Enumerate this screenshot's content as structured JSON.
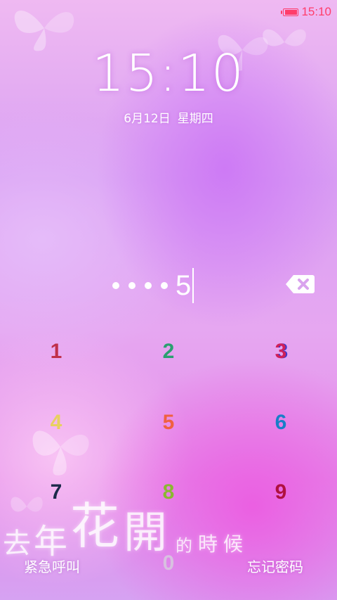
{
  "status_bar": {
    "time": "15:10",
    "battery_level": 0.95,
    "accent": "#ff3d6b"
  },
  "clock": {
    "time": "15:10"
  },
  "date": {
    "day": "6月12日",
    "weekday": "星期四"
  },
  "pin": {
    "masked_count": 4,
    "last_digit": "5"
  },
  "keypad": {
    "keys": [
      "1",
      "2",
      "3",
      "4",
      "5",
      "6",
      "7",
      "8",
      "9",
      "0"
    ]
  },
  "actions": {
    "emergency_call": "紧急呼叫",
    "forgot_password": "忘记密码"
  },
  "watermark": {
    "text": [
      "去",
      "年",
      "花",
      "開",
      "的",
      "時",
      "候"
    ]
  },
  "icons": {
    "backspace": "backspace-icon",
    "battery": "battery-icon",
    "decor": "butterfly-icon"
  }
}
